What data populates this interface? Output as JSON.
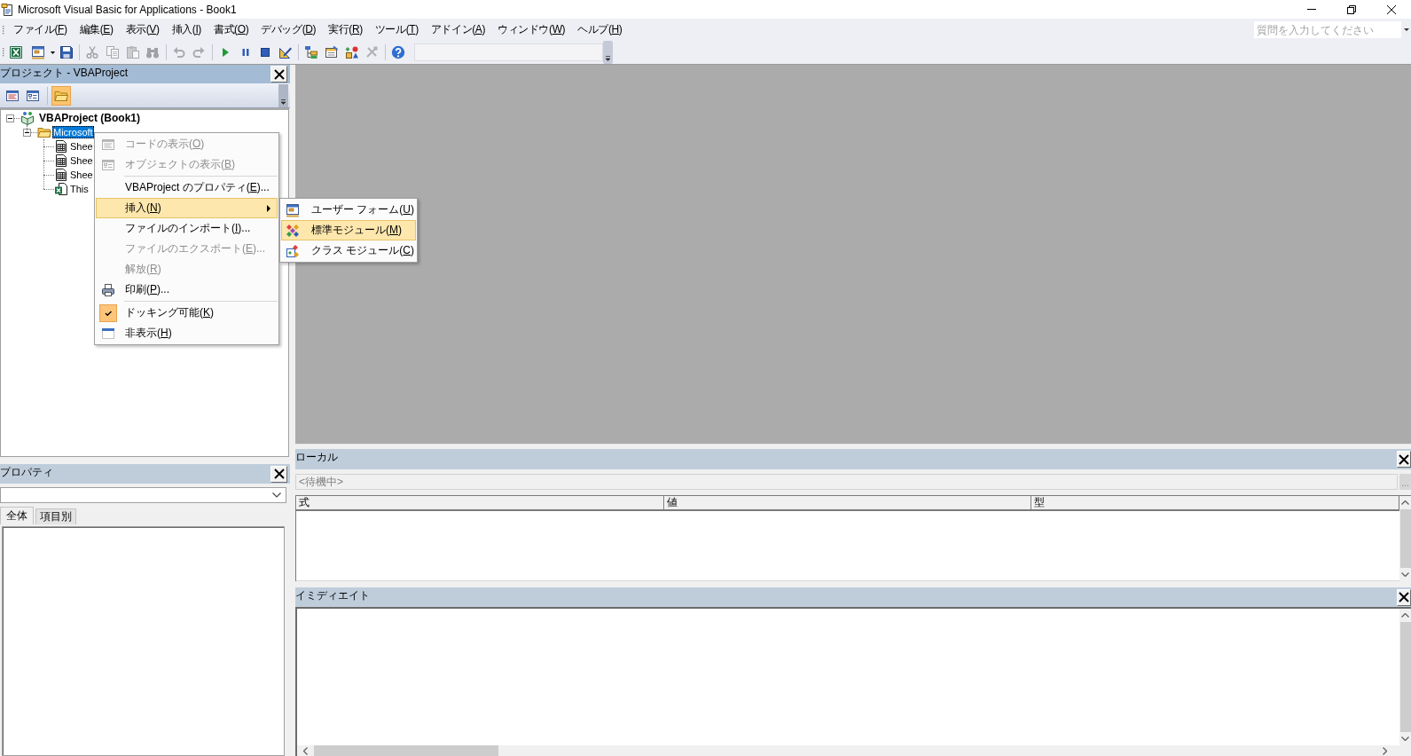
{
  "window": {
    "title": "Microsoft Visual Basic for Applications - Book1"
  },
  "menu_bar": [
    {
      "label": "ファイル(",
      "key": "F",
      "tail": ")"
    },
    {
      "label": "編集(",
      "key": "E",
      "tail": ")"
    },
    {
      "label": "表示(",
      "key": "V",
      "tail": ")"
    },
    {
      "label": "挿入(",
      "key": "I",
      "tail": ")"
    },
    {
      "label": "書式(",
      "key": "O",
      "tail": ")"
    },
    {
      "label": "デバッグ(",
      "key": "D",
      "tail": ")"
    },
    {
      "label": "実行(",
      "key": "R",
      "tail": ")"
    },
    {
      "label": "ツール(",
      "key": "T",
      "tail": ")"
    },
    {
      "label": "アドイン(",
      "key": "A",
      "tail": ")"
    },
    {
      "label": "ウィンドウ(",
      "key": "W",
      "tail": ")"
    },
    {
      "label": "ヘルプ(",
      "key": "H",
      "tail": ")"
    }
  ],
  "help_search": {
    "placeholder": "質問を入力してください"
  },
  "toolbar": [
    {
      "kind": "excel",
      "disabled": false
    },
    {
      "kind": "userform",
      "disabled": false
    },
    {
      "kind": "save",
      "disabled": false
    },
    {
      "kind": "separator"
    },
    {
      "kind": "cut",
      "disabled": true
    },
    {
      "kind": "copy",
      "disabled": true
    },
    {
      "kind": "paste",
      "disabled": true
    },
    {
      "kind": "find",
      "disabled": true
    },
    {
      "kind": "separator"
    },
    {
      "kind": "undo",
      "disabled": true
    },
    {
      "kind": "redo",
      "disabled": true
    },
    {
      "kind": "separator"
    },
    {
      "kind": "run",
      "disabled": false
    },
    {
      "kind": "break",
      "disabled": false
    },
    {
      "kind": "reset",
      "disabled": false
    },
    {
      "kind": "design",
      "disabled": false
    },
    {
      "kind": "separator"
    },
    {
      "kind": "explorer",
      "disabled": false
    },
    {
      "kind": "properties",
      "disabled": false
    },
    {
      "kind": "browser",
      "disabled": false
    },
    {
      "kind": "toolbox",
      "disabled": true
    },
    {
      "kind": "separator"
    },
    {
      "kind": "help",
      "disabled": false
    }
  ],
  "project_pane": {
    "title": "プロジェクト - VBAProject",
    "active": true,
    "tools": [
      {
        "kind": "code",
        "pressed": false
      },
      {
        "kind": "object",
        "pressed": false
      },
      {
        "kind": "separator"
      },
      {
        "kind": "folders",
        "pressed": true
      }
    ],
    "tree": [
      {
        "kind": "project",
        "label": "VBAProject (Book1)",
        "selected": false,
        "expanded": true,
        "children": [
          {
            "kind": "folder",
            "label": "Microsoft",
            "selected": true,
            "expanded": true,
            "children": [
              {
                "kind": "sheet",
                "label": "Shee",
                "selected": false
              },
              {
                "kind": "sheet",
                "label": "Shee",
                "selected": false
              },
              {
                "kind": "sheet",
                "label": "Shee",
                "selected": false
              },
              {
                "kind": "workbook",
                "label": "This",
                "selected": false
              }
            ]
          }
        ]
      }
    ]
  },
  "context_menu": {
    "items": [
      {
        "kind": "code",
        "label": "コードの表示(",
        "key": "O",
        "tail": ")",
        "disabled": true,
        "selected": false,
        "checked": false
      },
      {
        "kind": "object",
        "label": "オブジェクトの表示(",
        "key": "B",
        "tail": ")",
        "disabled": true,
        "selected": false,
        "checked": false
      },
      {
        "kind": "separator"
      },
      {
        "kind": "plain",
        "label": "VBAProject のプロパティ(",
        "key": "E",
        "tail": ")...",
        "disabled": false,
        "selected": false,
        "checked": false
      },
      {
        "kind": "plain",
        "label": "挿入(",
        "key": "N",
        "tail": ")",
        "disabled": false,
        "selected": true,
        "checked": false,
        "submenu": [
          {
            "kind": "userform",
            "label": "ユーザー フォーム(",
            "key": "U",
            "tail": ")",
            "selected": false
          },
          {
            "kind": "module",
            "label": "標準モジュール(",
            "key": "M",
            "tail": ")",
            "selected": true
          },
          {
            "kind": "class",
            "label": "クラス モジュール(",
            "key": "C",
            "tail": ")",
            "selected": false
          }
        ]
      },
      {
        "kind": "plain",
        "label": "ファイルのインポート(",
        "key": "I",
        "tail": ")...",
        "disabled": false,
        "selected": false,
        "checked": false
      },
      {
        "kind": "plain",
        "label": "ファイルのエクスポート(",
        "key": "E",
        "tail": ")...",
        "disabled": true,
        "selected": false,
        "checked": false
      },
      {
        "kind": "plain",
        "label": "解放(",
        "key": "R",
        "tail": ")",
        "disabled": true,
        "selected": false,
        "checked": false
      },
      {
        "kind": "printer",
        "label": "印刷(",
        "key": "P",
        "tail": ")...",
        "disabled": false,
        "selected": false,
        "checked": false
      },
      {
        "kind": "separator"
      },
      {
        "kind": "plain",
        "label": "ドッキング可能(",
        "key": "K",
        "tail": ")",
        "disabled": false,
        "selected": false,
        "checked": true
      },
      {
        "kind": "window",
        "label": "非表示(",
        "key": "H",
        "tail": ")",
        "disabled": false,
        "selected": false,
        "checked": false
      }
    ]
  },
  "properties_pane": {
    "title": "プロパティ",
    "active": false,
    "tabs": [
      {
        "label": "全体",
        "selected": true
      },
      {
        "label": "項目別",
        "selected": false
      }
    ]
  },
  "locals": {
    "title": "ローカル",
    "active": false,
    "context": "<待機中>",
    "context_button": "...",
    "columns": [
      "式",
      "値",
      "型"
    ]
  },
  "immediate": {
    "title": "イミディエイト",
    "active": false
  }
}
